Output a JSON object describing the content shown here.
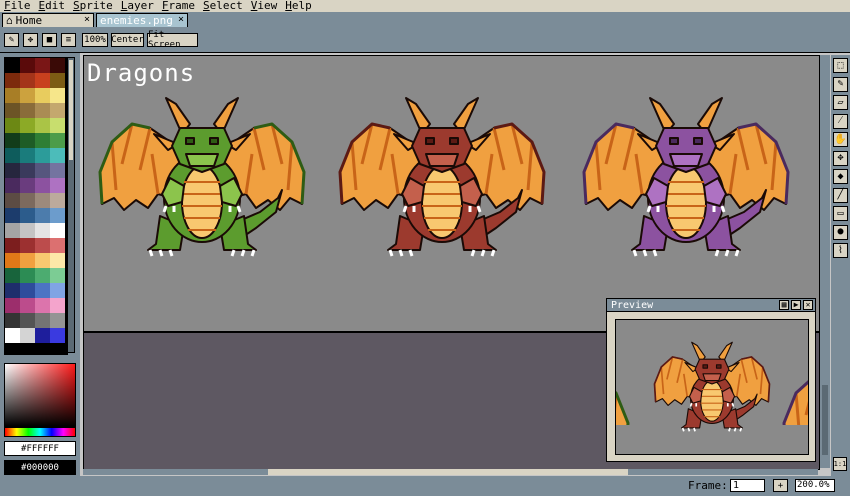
{
  "menu": [
    {
      "label": "File",
      "underline": "F",
      "rest": "ile"
    },
    {
      "label": "Edit",
      "underline": "E",
      "rest": "dit"
    },
    {
      "label": "Sprite",
      "underline": "S",
      "rest": "prite"
    },
    {
      "label": "Layer",
      "underline": "L",
      "rest": "ayer"
    },
    {
      "label": "Frame",
      "underline": "F",
      "rest": "rame"
    },
    {
      "label": "Select",
      "underline": "S",
      "rest": "elect"
    },
    {
      "label": "View",
      "underline": "V",
      "rest": "iew"
    },
    {
      "label": "Help",
      "underline": "H",
      "rest": "elp"
    }
  ],
  "tabs": {
    "home": "Home",
    "active": "enemies.png",
    "close": "×"
  },
  "toolbar": {
    "zoom_100": "100%",
    "center": "Center",
    "fit_screen": "Fit Screen"
  },
  "palette": [
    "#000000",
    "#5a0a0a",
    "#7a1616",
    "#3a0a06",
    "#7c2a0c",
    "#a4341a",
    "#c8401e",
    "#7c5c14",
    "#a87e26",
    "#cca23e",
    "#e8cc5e",
    "#f6e68a",
    "#6c5426",
    "#8a6c3a",
    "#aa8c54",
    "#c4a86e",
    "#6c8814",
    "#8caa26",
    "#aac446",
    "#c8de6e",
    "#123c1a",
    "#1e5c26",
    "#2e7e34",
    "#4c9c4a",
    "#0e5c5c",
    "#1a7c7c",
    "#2c9c9a",
    "#4cbcba",
    "#26263e",
    "#3a3a5c",
    "#56567e",
    "#7474a0",
    "#4a2a5e",
    "#6a3c7e",
    "#8c52a0",
    "#ae72c2",
    "#5c4c44",
    "#7c6a5e",
    "#9c8a7c",
    "#bcaa9c",
    "#1c3c6c",
    "#2c5c8c",
    "#4c7cac",
    "#6c9ccc",
    "#a4a4a4",
    "#c4c4c4",
    "#e4e4e4",
    "#ffffff",
    "#7c1e1e",
    "#9c3030",
    "#bc4c4c",
    "#dc7070",
    "#e07818",
    "#f0a040",
    "#f8c870",
    "#fde8a8",
    "#18643c",
    "#2c8c54",
    "#4cac70",
    "#7ccc94",
    "#1e2e6c",
    "#2e4c9c",
    "#4c74c4",
    "#80a4e4",
    "#9c2e6c",
    "#bc4c8c",
    "#dc74ac",
    "#f4a4cc",
    "#343434",
    "#545454",
    "#747474",
    "#949494",
    "#ffffff",
    "#d4d4d4",
    "#1e1e9c",
    "#3a3ae0"
  ],
  "colors": {
    "fg_hex": "#FFFFFF",
    "bg_hex": "#000000",
    "accent": "#7b8c98",
    "panel": "#d9d4c4",
    "canvas_bg": "#8a8a8a",
    "outside_bg": "#5e5862"
  },
  "sheet": {
    "title": "Dragons"
  },
  "dragons": [
    {
      "name": "green-dragon",
      "body": "#5c9c2e",
      "body_dark": "#2e5c14",
      "body_light": "#8cc44c",
      "wing": "#f0a040",
      "wing_dark": "#c86418",
      "belly": "#f8c870"
    },
    {
      "name": "red-dragon",
      "body": "#9c3a2e",
      "body_dark": "#5c1a14",
      "body_light": "#c4604c",
      "wing": "#f0a040",
      "wing_dark": "#c86418",
      "belly": "#f8c870"
    },
    {
      "name": "purple-dragon",
      "body": "#8c52a0",
      "body_dark": "#4a2a5e",
      "body_light": "#ae72c2",
      "wing": "#f0a040",
      "wing_dark": "#c86418",
      "belly": "#f8c870"
    }
  ],
  "preview": {
    "title": "Preview",
    "btn_grid": "▦",
    "btn_play": "▶",
    "btn_close": "✕"
  },
  "tools": [
    "marquee-icon",
    "pencil-icon",
    "eraser-icon",
    "eyedropper-icon",
    "hand-icon",
    "move-icon",
    "fill-icon",
    "line-icon",
    "rectangle-icon",
    "ellipse-icon",
    "brush-icon"
  ],
  "zoom_1to1": "1:1",
  "status": {
    "frame_label": "Frame:",
    "frame_value": "1",
    "add_frame": "+",
    "zoom_value": "200.0%"
  }
}
